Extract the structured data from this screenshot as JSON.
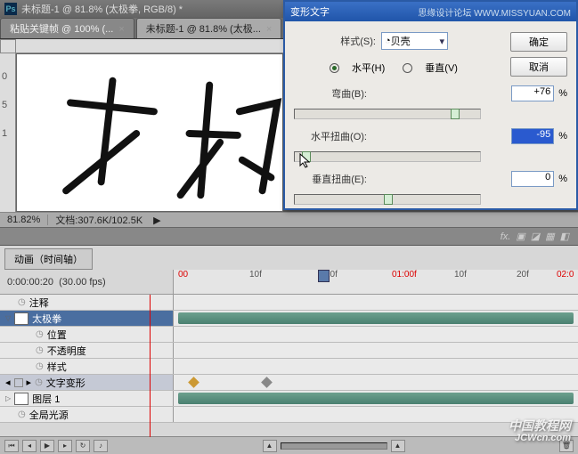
{
  "app": {
    "title": "未标题-1 @ 81.8% (太极拳, RGB/8) *"
  },
  "tabs": [
    {
      "label": "粘贴关键帧 @ 100% (...",
      "active": false
    },
    {
      "label": "未标题-1 @ 81.8% (太极...",
      "active": true
    }
  ],
  "status": {
    "zoom": "81.82%",
    "doc": "文档:307.6K/102.5K"
  },
  "dialog": {
    "title": "变形文字",
    "site": "思缘设计论坛  WWW.MISSYUAN.COM",
    "style_label": "样式(S):",
    "style_value": "贝壳",
    "orient_h": "水平(H)",
    "orient_v": "垂直(V)",
    "bend_label": "弯曲(B):",
    "bend_value": "+76",
    "hdist_label": "水平扭曲(O):",
    "hdist_value": "-95",
    "vdist_label": "垂直扭曲(E):",
    "vdist_value": "0",
    "pct": "%",
    "ok": "确定",
    "cancel": "取消"
  },
  "timeline": {
    "tab": "动画（时间轴）",
    "timecode": "0:00:00:20",
    "fps": "(30.00 fps)",
    "ticks": {
      "t0": "00",
      "t1": "10f",
      "t2": "20f",
      "t3": "01:00f",
      "t4": "10f",
      "t5": "20f",
      "t6": "02:0"
    },
    "rows": {
      "comments": "注释",
      "main_layer": "太极拳",
      "position": "位置",
      "opacity": "不透明度",
      "style": "样式",
      "text_warp": "文字变形",
      "layer1": "图层 1",
      "global_light": "全局光源"
    }
  },
  "watermark": {
    "cn": "中国教程网",
    "en": "JCWcn.com"
  }
}
